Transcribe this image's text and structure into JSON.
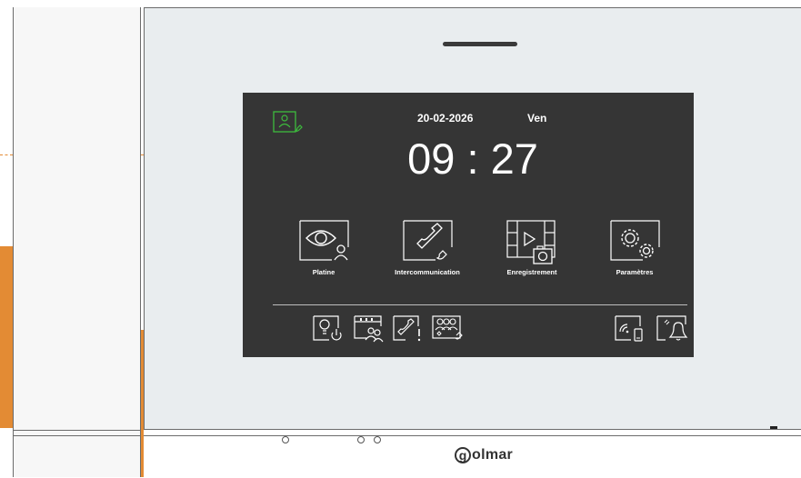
{
  "screen": {
    "date": "20-02-2026",
    "day": "Ven",
    "time": "09 : 27"
  },
  "menu": [
    {
      "label": "Platine",
      "icon": "eye-camera-icon"
    },
    {
      "label": "Intercommunication",
      "icon": "handset-icon"
    },
    {
      "label": "Enregistrement",
      "icon": "film-camera-icon"
    },
    {
      "label": "Paramètres",
      "icon": "gears-icon"
    }
  ],
  "status_icons": [
    "active-call-icon"
  ],
  "shortcuts_left": [
    "light-power-icon",
    "calendar-contacts-icon",
    "call-alert-icon",
    "group-call-icon"
  ],
  "shortcuts_right": [
    "wifi-phone-icon",
    "bell-mute-icon"
  ],
  "brand": {
    "initial": "g",
    "text": "olmar"
  },
  "colors": {
    "screen_bg": "#353535",
    "device_bg": "#e9edef",
    "accent_orange": "#e38b34",
    "active_icon_green": "#3dbb3d"
  }
}
